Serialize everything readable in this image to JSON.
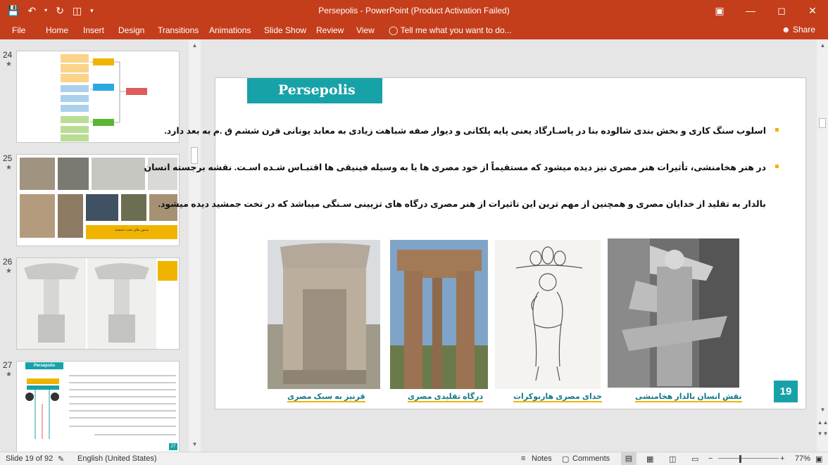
{
  "window": {
    "title": "Persepolis - PowerPoint (Product Activation Failed)",
    "controls": [
      "restore-ribbon",
      "minimize",
      "maximize",
      "close"
    ]
  },
  "ribbon": {
    "tabs": [
      "File",
      "Home",
      "Insert",
      "Design",
      "Transitions",
      "Animations",
      "Slide Show",
      "Review",
      "View"
    ],
    "tell_me": "Tell me what you want to do...",
    "share": "Share"
  },
  "thumbnails": [
    {
      "number": "24",
      "star": "★"
    },
    {
      "number": "25",
      "star": "★",
      "caption": "ستون های تخت جمشید"
    },
    {
      "number": "26",
      "star": "★"
    },
    {
      "number": "27",
      "star": "★",
      "title": "Persepolis",
      "page": "27"
    }
  ],
  "slide": {
    "title": "Persepolis",
    "paragraphs": [
      "اسلوب سنگ کاری و بخش بندی شالوده بنا در پاسـارگاد یعنی پایه پلکانی و دیوار صفه شباهت زیادی به معابد یونانی قرن ششم ق .م به بعد دارد.",
      "در هنر هخامنشی، تأثیرات هنر مصری نیز دیده میشود که مستقیماً از خود مصری ها یا به وسیله فینیقی ها اقتبـاس شـده اسـت. نقشه برجسته انسان",
      "بالدار به تقلید از خدایان مصری و همچنین از مهم ترین این تاثیرات از هنر مصری درگاه های تزیینی سـنگی میباشد که در تخت جمشید دیده میشود."
    ],
    "captions": [
      "قرنیز به سبک مصری",
      "درگاه تقلیدی مصری",
      "خدای مصری هاربوکرات",
      "نقش انسان بالدار هخامنشی"
    ],
    "page_number": "19"
  },
  "status": {
    "slide_info": "Slide 19 of 92",
    "language": "English (United States)",
    "notes": "Notes",
    "comments": "Comments",
    "zoom": "77%"
  }
}
